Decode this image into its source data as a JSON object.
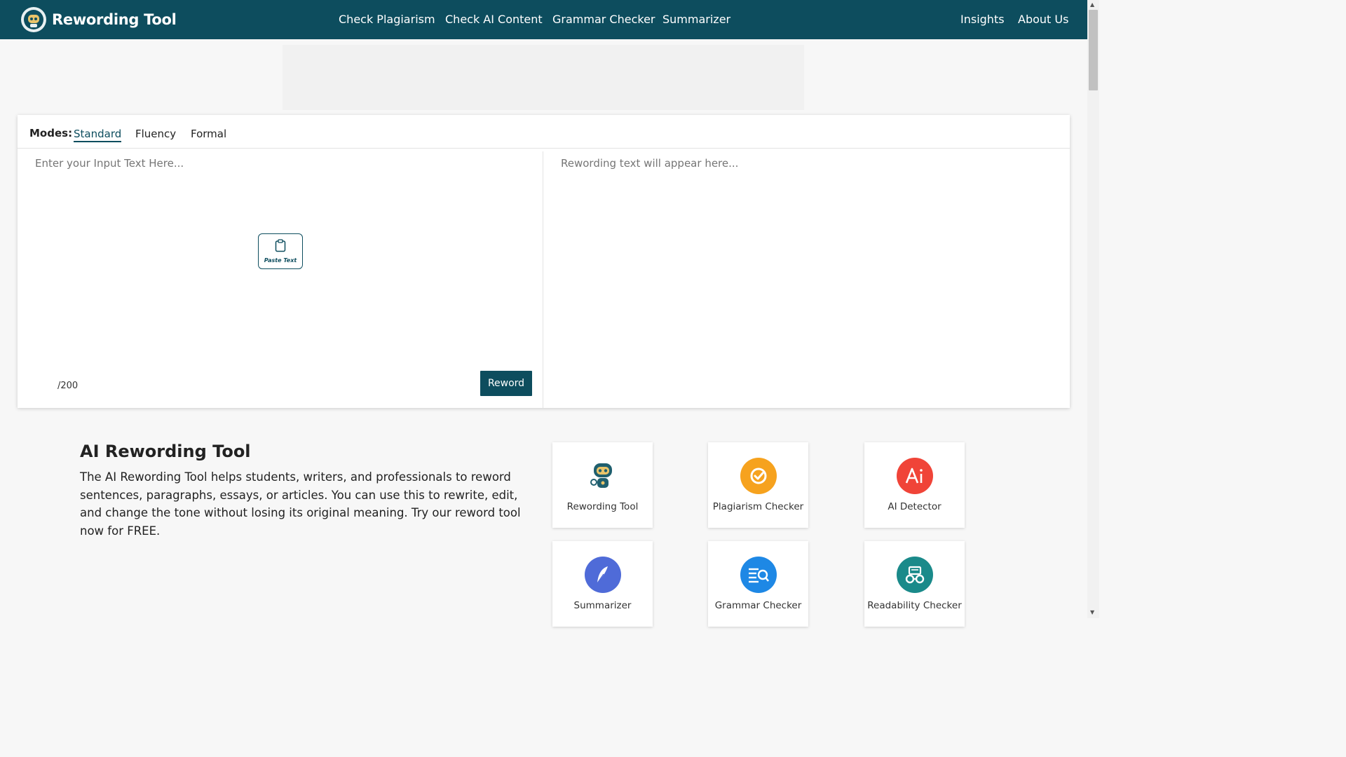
{
  "header": {
    "brand": "Rewording Tool",
    "nav": [
      "Check Plagiarism",
      "Check AI Content",
      "Grammar Checker",
      "Summarizer"
    ],
    "nav_right": [
      "Insights",
      "About Us"
    ]
  },
  "editor": {
    "modes_label": "Modes:",
    "modes": [
      "Standard",
      "Fluency",
      "Formal"
    ],
    "active_mode": "Standard",
    "input_placeholder": "Enter your Input Text Here...",
    "paste_label": "Paste Text",
    "counter": "/200",
    "reword_label": "Reword",
    "output_placeholder": "Rewording text will appear here..."
  },
  "about": {
    "title": "AI Rewording Tool",
    "description": "The AI Rewording Tool helps students, writers, and professionals to reword sentences, paragraphs, essays, or articles. You can use this to rewrite, edit, and change the tone without losing its original meaning. Try our reword tool now for FREE."
  },
  "tools": [
    {
      "label": "Rewording Tool",
      "icon": "robot-icon",
      "color": "#ffffff"
    },
    {
      "label": "Plagiarism Checker",
      "icon": "check-badge-icon",
      "color": "#f6a21e"
    },
    {
      "label": "AI Detector",
      "icon": "ai-icon",
      "color": "#f04438"
    },
    {
      "label": "Summarizer",
      "icon": "feather-icon",
      "color": "#4f6bd8"
    },
    {
      "label": "Grammar Checker",
      "icon": "search-lines-icon",
      "color": "#1e88e5"
    },
    {
      "label": "Readability Checker",
      "icon": "glasses-icon",
      "color": "#1a8a8a"
    }
  ],
  "colors": {
    "primary": "#0d4d5e",
    "page_bg": "#f7f7f7"
  }
}
